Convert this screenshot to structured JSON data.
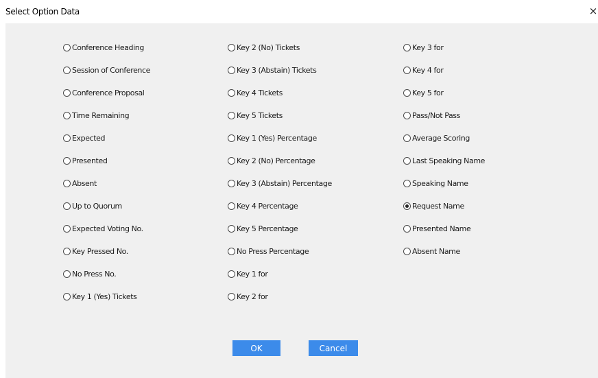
{
  "dialog": {
    "title": "Select Option Data",
    "close_glyph": "×"
  },
  "columns": [
    {
      "items": [
        {
          "label": "Conference Heading",
          "checked": false
        },
        {
          "label": "Session of Conference",
          "checked": false
        },
        {
          "label": "Conference Proposal",
          "checked": false
        },
        {
          "label": "Time Remaining",
          "checked": false
        },
        {
          "label": "Expected",
          "checked": false
        },
        {
          "label": "Presented",
          "checked": false
        },
        {
          "label": "Absent",
          "checked": false
        },
        {
          "label": "Up to Quorum",
          "checked": false
        },
        {
          "label": "Expected Voting No.",
          "checked": false
        },
        {
          "label": "Key Pressed No.",
          "checked": false
        },
        {
          "label": "No Press No.",
          "checked": false
        },
        {
          "label": "Key 1 (Yes) Tickets",
          "checked": false
        }
      ]
    },
    {
      "items": [
        {
          "label": "Key 2 (No) Tickets",
          "checked": false
        },
        {
          "label": "Key 3 (Abstain) Tickets",
          "checked": false
        },
        {
          "label": "Key 4 Tickets",
          "checked": false
        },
        {
          "label": "Key 5 Tickets",
          "checked": false
        },
        {
          "label": "Key 1 (Yes)  Percentage",
          "checked": false
        },
        {
          "label": "Key 2 (No)  Percentage",
          "checked": false
        },
        {
          "label": "Key 3 (Abstain)  Percentage",
          "checked": false
        },
        {
          "label": "Key 4 Percentage",
          "checked": false
        },
        {
          "label": "Key 5 Percentage",
          "checked": false
        },
        {
          "label": "No Press Percentage",
          "checked": false
        },
        {
          "label": "Key 1 for",
          "checked": false
        },
        {
          "label": "Key 2 for",
          "checked": false
        }
      ]
    },
    {
      "items": [
        {
          "label": "Key 3 for",
          "checked": false
        },
        {
          "label": "Key 4 for",
          "checked": false
        },
        {
          "label": "Key 5 for",
          "checked": false
        },
        {
          "label": "Pass/Not Pass",
          "checked": false
        },
        {
          "label": "Average Scoring",
          "checked": false
        },
        {
          "label": "Last Speaking Name",
          "checked": false
        },
        {
          "label": "Speaking Name",
          "checked": false
        },
        {
          "label": "Request Name",
          "checked": true
        },
        {
          "label": "Presented Name",
          "checked": false
        },
        {
          "label": "Absent Name",
          "checked": false
        }
      ]
    }
  ],
  "buttons": {
    "ok_label": "OK",
    "cancel_label": "Cancel"
  },
  "colors": {
    "button_bg": "#3c8bea",
    "panel_bg": "#f0f0f0"
  }
}
